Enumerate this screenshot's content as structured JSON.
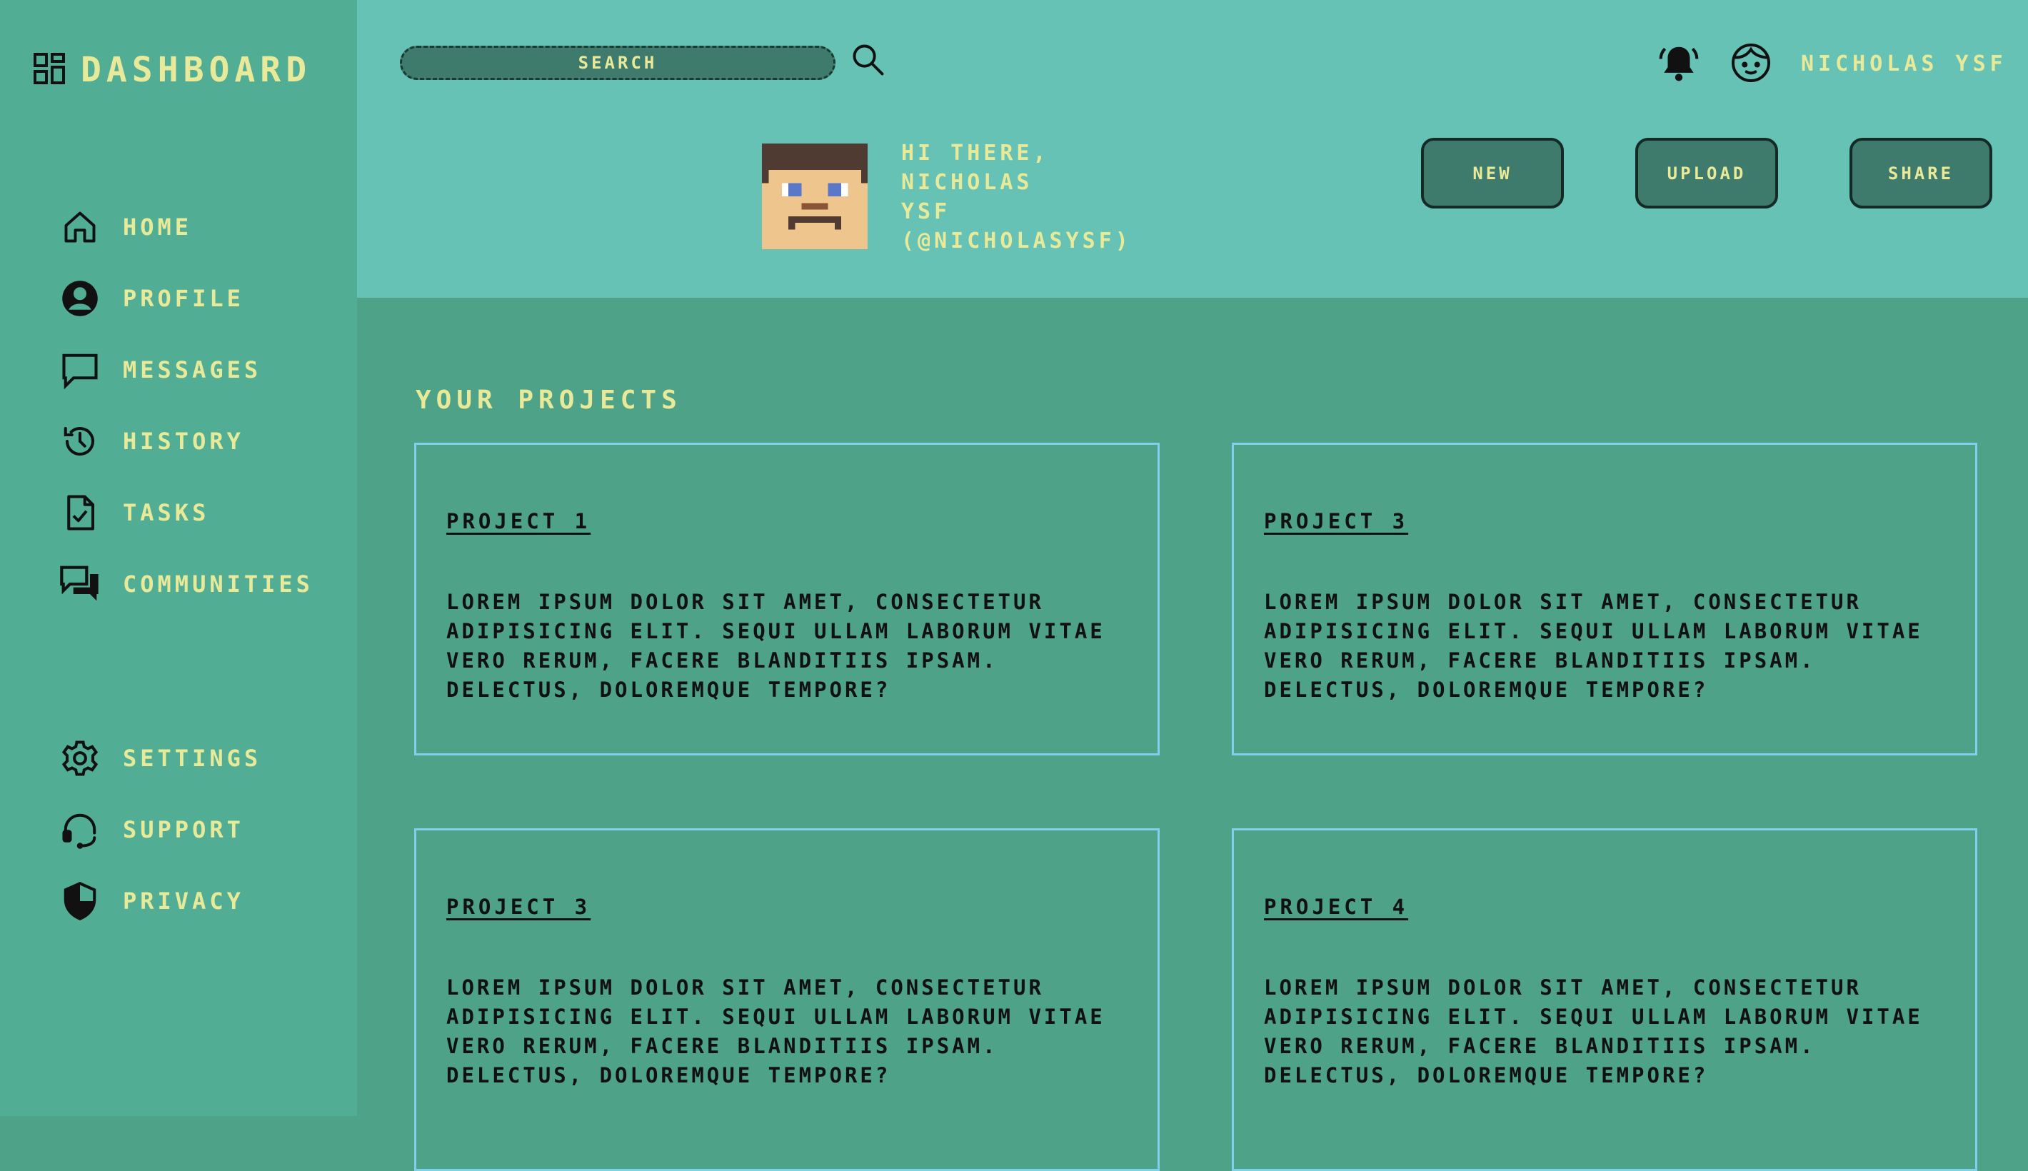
{
  "sidebar": {
    "brand": {
      "title": "DASHBOARD",
      "icon": "dashboard-grid-icon"
    },
    "nav_items": [
      {
        "label": "HOME",
        "icon": "home-icon"
      },
      {
        "label": "PROFILE",
        "icon": "profile-icon"
      },
      {
        "label": "MESSAGES",
        "icon": "message-icon"
      },
      {
        "label": "HISTORY",
        "icon": "history-icon"
      },
      {
        "label": "TASKS",
        "icon": "task-icon"
      },
      {
        "label": "COMMUNITIES",
        "icon": "communities-icon"
      }
    ],
    "secondary_items": [
      {
        "label": "SETTINGS",
        "icon": "gear-icon"
      },
      {
        "label": "SUPPORT",
        "icon": "support-headset-icon"
      },
      {
        "label": "PRIVACY",
        "icon": "shield-icon"
      }
    ]
  },
  "header": {
    "search": {
      "placeholder": "SEARCH",
      "value": ""
    },
    "user_name": "NICHOLAS YSF",
    "icons": {
      "search": "search-icon",
      "notifications": "bell-icon",
      "account": "face-icon"
    },
    "greeting": [
      "HI THERE,",
      "NICHOLAS",
      "YSF",
      "(@NICHOLASYSF)"
    ],
    "actions": {
      "new": "NEW",
      "upload": "UPLOAD",
      "share": "SHARE"
    }
  },
  "main": {
    "section_title": "YOUR PROJECTS",
    "projects": [
      {
        "title": "PROJECT 1",
        "body": "LOREM IPSUM DOLOR SIT AMET, CONSECTETUR ADIPISICING ELIT. SEQUI ULLAM LABORUM VITAE VERO RERUM, FACERE BLANDITIIS IPSAM. DELECTUS, DOLOREMQUE TEMPORE?"
      },
      {
        "title": "PROJECT 3",
        "body": "LOREM IPSUM DOLOR SIT AMET, CONSECTETUR ADIPISICING ELIT. SEQUI ULLAM LABORUM VITAE VERO RERUM, FACERE BLANDITIIS IPSAM. DELECTUS, DOLOREMQUE TEMPORE?"
      },
      {
        "title": "PROJECT 3",
        "body": "LOREM IPSUM DOLOR SIT AMET, CONSECTETUR ADIPISICING ELIT. SEQUI ULLAM LABORUM VITAE VERO RERUM, FACERE BLANDITIIS IPSAM. DELECTUS, DOLOREMQUE TEMPORE?"
      },
      {
        "title": "PROJECT 4",
        "body": "LOREM IPSUM DOLOR SIT AMET, CONSECTETUR ADIPISICING ELIT. SEQUI ULLAM LABORUM VITAE VERO RERUM, FACERE BLANDITIIS IPSAM. DELECTUS, DOLOREMQUE TEMPORE?"
      }
    ]
  },
  "colors": {
    "sidebar_bg": "#51ae94",
    "topbar_bg": "#66c2b4",
    "main_bg": "#4ea288",
    "accent_text": "#e8ea9a",
    "button_bg": "#3e7b6c",
    "card_border": "#7fd0ec"
  }
}
